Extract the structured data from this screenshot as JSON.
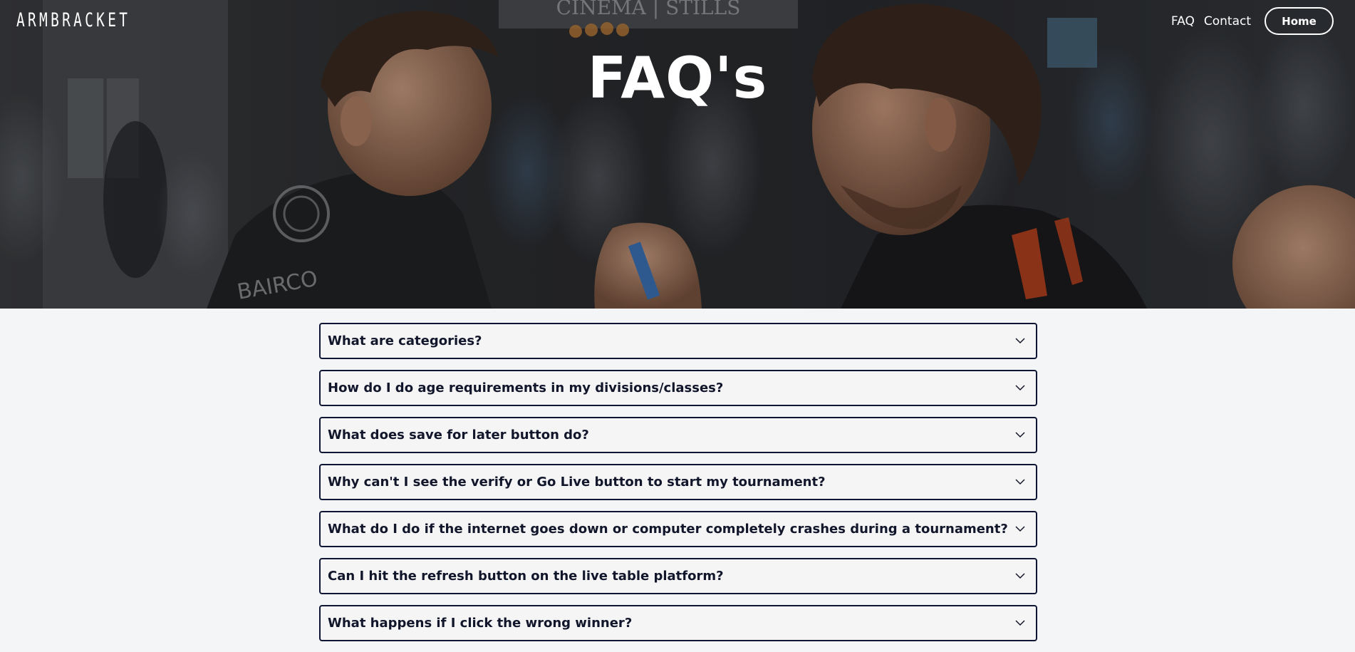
{
  "header": {
    "logo": "ARMBRACKET",
    "nav": {
      "faq": "FAQ",
      "contact": "Contact",
      "home": "Home"
    }
  },
  "hero": {
    "title": "FAQ's",
    "background_sign": "CINEMA | STILLS"
  },
  "faq": {
    "items": [
      {
        "question": "What are categories?"
      },
      {
        "question": "How do I do age requirements in my divisions/classes?"
      },
      {
        "question": "What does save for later button do?"
      },
      {
        "question": "Why can't I see the verify or Go Live button to start my tournament?"
      },
      {
        "question": "What do I do if the internet goes down or computer completely crashes during a tournament?"
      },
      {
        "question": "Can I hit the refresh button on the live table platform?"
      },
      {
        "question": "What happens if I click the wrong winner?"
      }
    ]
  },
  "colors": {
    "page_bg": "#f4f5f6",
    "faq_border": "#0f1635",
    "faq_text": "#12162b",
    "header_text": "#ffffff"
  }
}
